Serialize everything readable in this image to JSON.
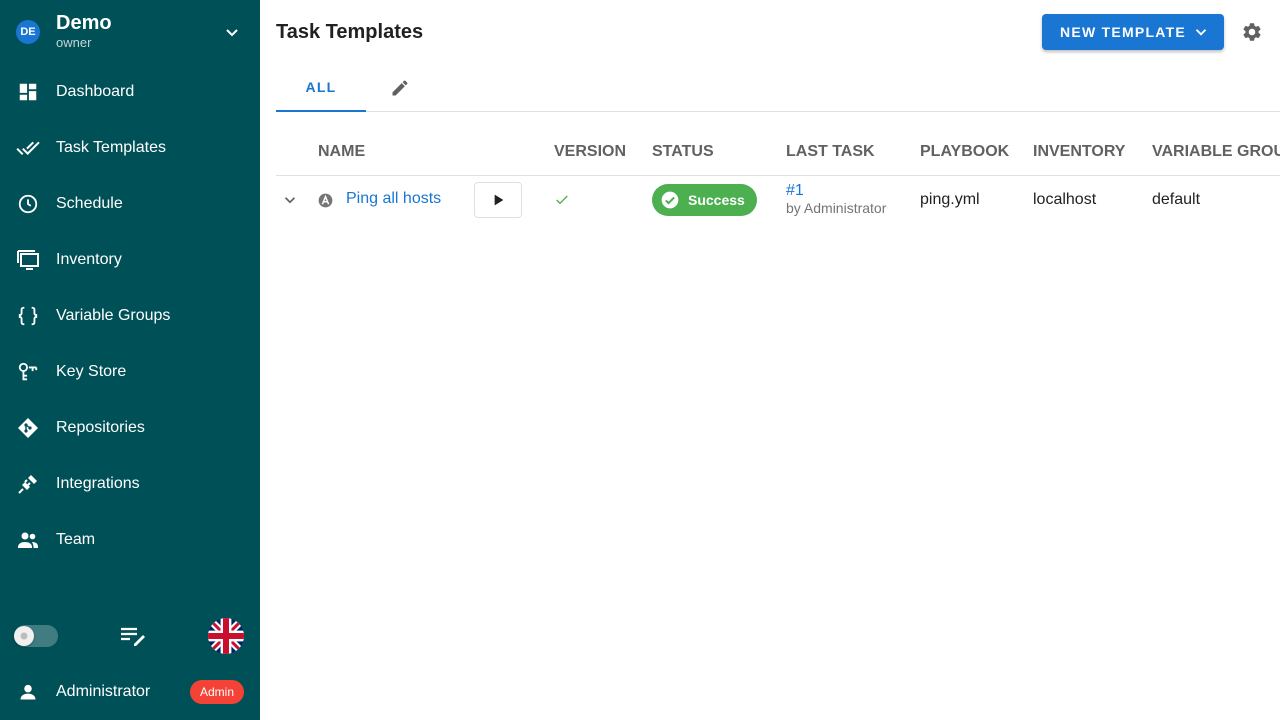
{
  "project": {
    "avatar": "DE",
    "name": "Demo",
    "role": "owner"
  },
  "nav": [
    {
      "label": "Dashboard",
      "icon": "dashboard-icon"
    },
    {
      "label": "Task Templates",
      "icon": "done-all-icon"
    },
    {
      "label": "Schedule",
      "icon": "clock-icon"
    },
    {
      "label": "Inventory",
      "icon": "monitor-icon"
    },
    {
      "label": "Variable Groups",
      "icon": "code-braces-icon"
    },
    {
      "label": "Key Store",
      "icon": "key-icon"
    },
    {
      "label": "Repositories",
      "icon": "git-icon"
    },
    {
      "label": "Integrations",
      "icon": "plug-icon"
    },
    {
      "label": "Team",
      "icon": "team-icon"
    }
  ],
  "user": {
    "name": "Administrator",
    "badge": "Admin"
  },
  "header": {
    "title": "Task Templates",
    "new_button": "NEW TEMPLATE"
  },
  "tabs": {
    "all": "ALL"
  },
  "table": {
    "columns": [
      "NAME",
      "VERSION",
      "STATUS",
      "LAST TASK",
      "PLAYBOOK",
      "INVENTORY",
      "VARIABLE GROUP"
    ],
    "rows": [
      {
        "name": "Ping all hosts",
        "status": "Success",
        "last_task": "#1",
        "last_task_by": "by Administrator",
        "playbook": "ping.yml",
        "inventory": "localhost",
        "variable_group": "default"
      }
    ]
  },
  "colors": {
    "sidebar": "#005057",
    "accent": "#1976d2",
    "success": "#4caf50",
    "admin": "#f44336"
  }
}
